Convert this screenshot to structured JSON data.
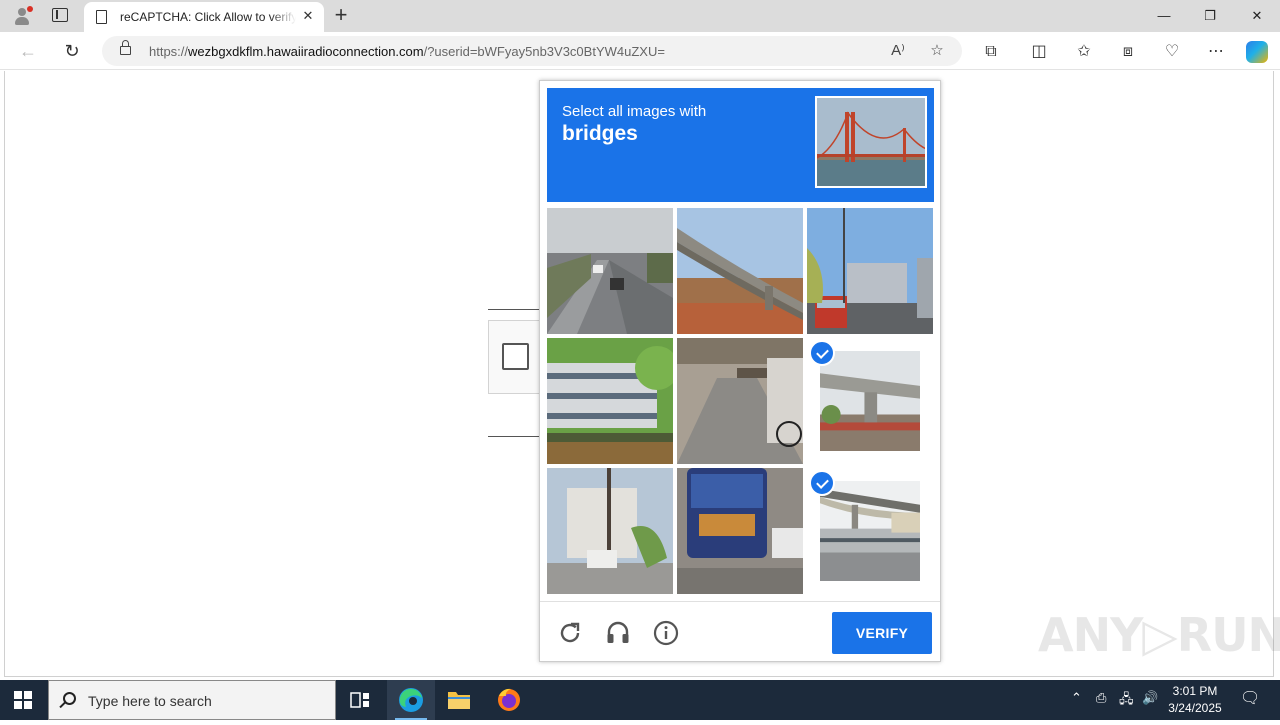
{
  "browser": {
    "tab_title": "reCAPTCHA: Click Allow to verify that you are not a robot",
    "tab_close": "✕",
    "new_tab": "+",
    "window_controls": {
      "minimize": "—",
      "restore": "❐",
      "close": "✕"
    },
    "nav": {
      "back": "←",
      "refresh": "↻"
    },
    "url": {
      "scheme": "https://",
      "host": "wezbgxdkflm.hawaiiradioconnection.com",
      "path": "/?userid=bWFyay5nb3V3c0BtYW4uZXU="
    },
    "toolbar_icons": [
      "read-aloud-icon",
      "favorite-star-icon",
      "extensions-icon",
      "split-screen-icon",
      "favorites-icon",
      "collections-icon",
      "browser-essentials-icon",
      "more-menu-icon",
      "copilot-icon"
    ]
  },
  "captcha": {
    "prompt_line1": "Select all images with",
    "prompt_target": "bridges",
    "tiles": [
      {
        "id": 0,
        "subject": "highway with cars",
        "selected": false
      },
      {
        "id": 1,
        "subject": "elevated road bridge",
        "selected": false
      },
      {
        "id": 2,
        "subject": "street with bus and buildings",
        "selected": false
      },
      {
        "id": 3,
        "subject": "multi-level parking structure",
        "selected": false
      },
      {
        "id": 4,
        "subject": "alley with bicycle",
        "selected": false
      },
      {
        "id": 5,
        "subject": "overpass bridge pillar",
        "selected": true
      },
      {
        "id": 6,
        "subject": "residential street with car",
        "selected": false
      },
      {
        "id": 7,
        "subject": "rear of bus",
        "selected": false
      },
      {
        "id": 8,
        "subject": "overpass bridge",
        "selected": true
      }
    ],
    "footer": {
      "reload_icon": "reload-icon",
      "audio_icon": "headphones-icon",
      "info_icon": "info-icon",
      "verify_label": "VERIFY"
    },
    "colors": {
      "accent": "#1a73e8"
    }
  },
  "watermark": "ANY▷RUN",
  "taskbar": {
    "search_placeholder": "Type here to search",
    "time": "3:01 PM",
    "date": "3/24/2025"
  }
}
